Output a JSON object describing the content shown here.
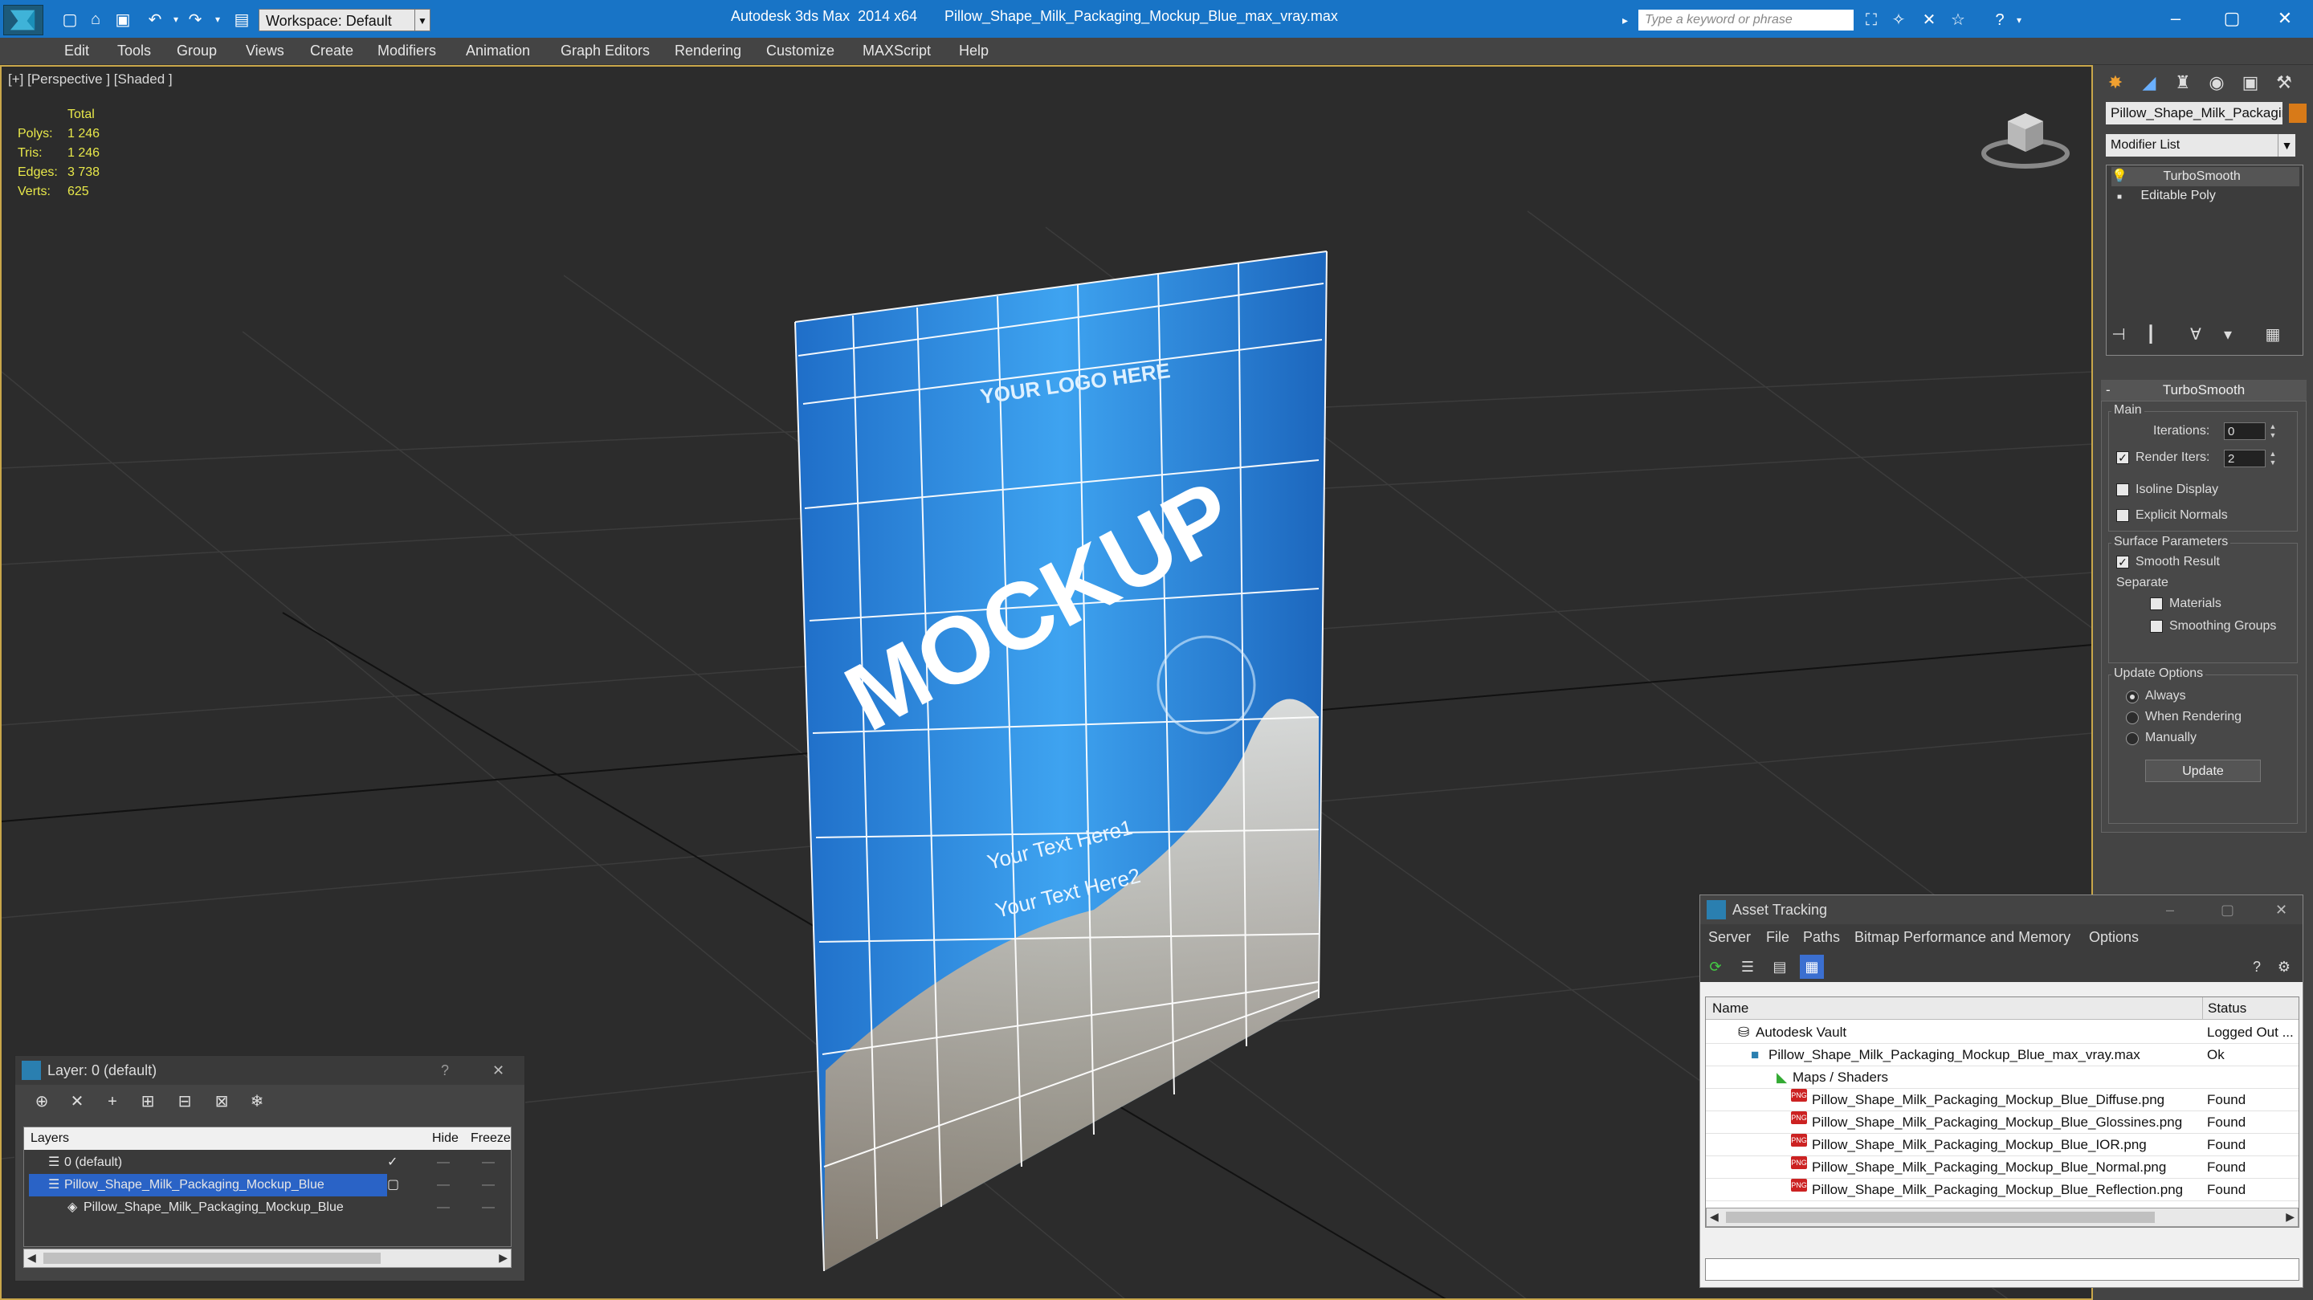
{
  "titlebar": {
    "app_title": "Autodesk 3ds Max  2014 x64",
    "file_name": "Pillow_Shape_Milk_Packaging_Mockup_Blue_max_vray.max",
    "workspace": "Workspace: Default",
    "search_placeholder": "Type a keyword or phrase"
  },
  "menubar": {
    "items": [
      "Edit",
      "Tools",
      "Group",
      "Views",
      "Create",
      "Modifiers",
      "Animation",
      "Graph Editors",
      "Rendering",
      "Customize",
      "MAXScript",
      "Help"
    ]
  },
  "viewport": {
    "label": "[+] [Perspective ] [Shaded ]",
    "stats": {
      "header": "Total",
      "rows": [
        {
          "label": "Polys:",
          "value": "1 246"
        },
        {
          "label": "Tris:",
          "value": "1 246"
        },
        {
          "label": "Edges:",
          "value": "3 738"
        },
        {
          "label": "Verts:",
          "value": "625"
        }
      ]
    },
    "pack_text": {
      "logo": "YOUR LOGO HERE",
      "main": "MOCKUP",
      "text1": "Your Text Here1",
      "text2": "Your Text Here2"
    }
  },
  "command_panel": {
    "object_name": "Pillow_Shape_Milk_Packaging",
    "modifier_list": "Modifier List",
    "stack": [
      "TurboSmooth",
      "Editable Poly"
    ],
    "rollout_title": "TurboSmooth",
    "main_label": "Main",
    "iterations_label": "Iterations:",
    "iterations_value": "0",
    "render_iters_label": "Render Iters:",
    "render_iters_value": "2",
    "isoline": "Isoline Display",
    "explicit_normals": "Explicit Normals",
    "surface_params": "Surface Parameters",
    "smooth_result": "Smooth Result",
    "separate": "Separate",
    "materials": "Materials",
    "smoothing_groups": "Smoothing Groups",
    "update_options": "Update Options",
    "always": "Always",
    "when_rendering": "When Rendering",
    "manually": "Manually",
    "update_button": "Update"
  },
  "layer_window": {
    "title": "Layer: 0 (default)",
    "help": "?",
    "col_layers": "Layers",
    "col_hide": "Hide",
    "col_freeze": "Freeze",
    "rows": [
      {
        "name": "0 (default)"
      },
      {
        "name": "Pillow_Shape_Milk_Packaging_Mockup_Blue"
      },
      {
        "name": "Pillow_Shape_Milk_Packaging_Mockup_Blue"
      }
    ]
  },
  "asset_tracking": {
    "title": "Asset Tracking",
    "menu": [
      "Server",
      "File",
      "Paths",
      "Bitmap Performance and Memory",
      "Options"
    ],
    "col_name": "Name",
    "col_status": "Status",
    "rows": [
      {
        "name": "Autodesk Vault",
        "status": "Logged Out ..."
      },
      {
        "name": "Pillow_Shape_Milk_Packaging_Mockup_Blue_max_vray.max",
        "status": "Ok"
      },
      {
        "name": "Maps / Shaders",
        "status": ""
      },
      {
        "name": "Pillow_Shape_Milk_Packaging_Mockup_Blue_Diffuse.png",
        "status": "Found"
      },
      {
        "name": "Pillow_Shape_Milk_Packaging_Mockup_Blue_Glossines.png",
        "status": "Found"
      },
      {
        "name": "Pillow_Shape_Milk_Packaging_Mockup_Blue_IOR.png",
        "status": "Found"
      },
      {
        "name": "Pillow_Shape_Milk_Packaging_Mockup_Blue_Normal.png",
        "status": "Found"
      },
      {
        "name": "Pillow_Shape_Milk_Packaging_Mockup_Blue_Reflection.png",
        "status": "Found"
      }
    ]
  },
  "colors": {
    "titlebar": "#1874c6",
    "viewport_border": "#c9a74a",
    "selection": "#2a63c6",
    "pack_blue": "#2e8fe0"
  }
}
